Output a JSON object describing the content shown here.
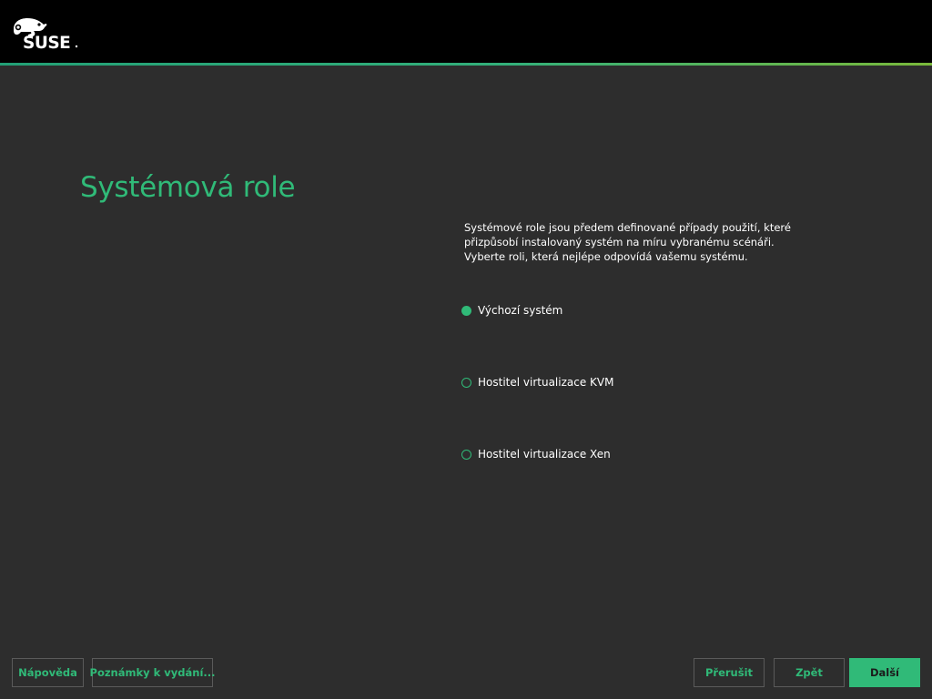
{
  "header": {
    "logo_text": "SUSE",
    "logo_icon": "chameleon-icon"
  },
  "page": {
    "title": "Systémová role",
    "description": "Systémové role jsou předem definované případy použití, které přizpůsobí instalovaný systém na míru vybranému scénáři. Vyberte roli, která nejlépe odpovídá vašemu systému."
  },
  "roles": [
    {
      "label": "Výchozí systém",
      "selected": true
    },
    {
      "label": "Hostitel virtualizace KVM",
      "selected": false
    },
    {
      "label": "Hostitel virtualizace Xen",
      "selected": false
    }
  ],
  "buttons": {
    "help": "Nápověda",
    "release_notes": "Poznámky k vydání...",
    "abort": "Přerušit",
    "back": "Zpět",
    "next": "Další"
  },
  "colors": {
    "accent": "#30ba78",
    "background": "#2d2d2d",
    "header": "#000000"
  }
}
